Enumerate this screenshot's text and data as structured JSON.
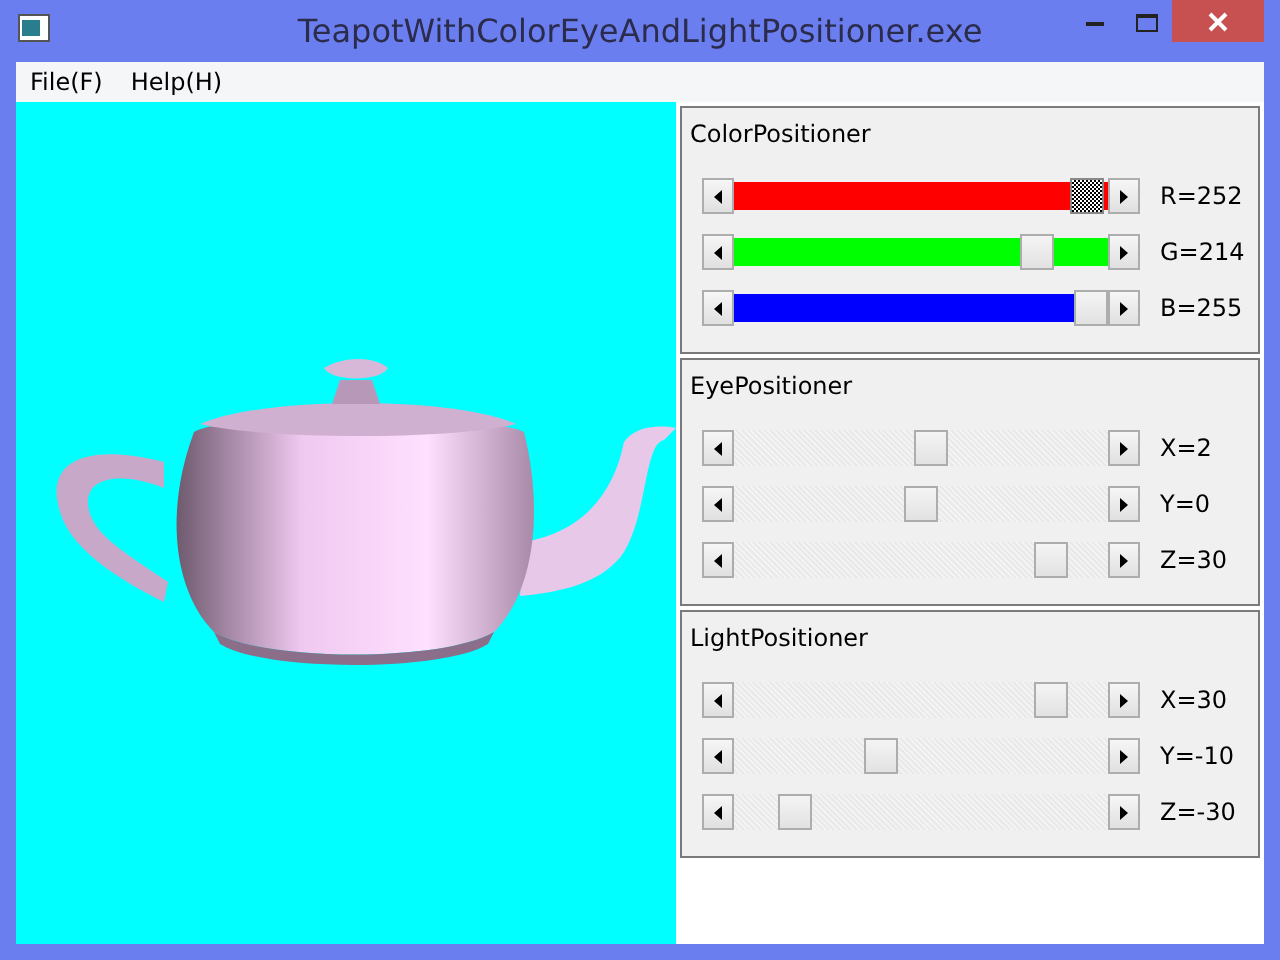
{
  "window": {
    "title": "TeapotWithColorEyeAndLightPositioner.exe"
  },
  "menu": [
    {
      "label": "File(F)"
    },
    {
      "label": "Help(H)"
    }
  ],
  "panels": [
    {
      "title": "ColorPositioner",
      "sliders": [
        {
          "level": 0.99,
          "color": "#ff0000",
          "focused": true,
          "reading": "R=252"
        },
        {
          "level": 0.84,
          "color": "#00ff00",
          "focused": false,
          "reading": "G=214"
        },
        {
          "level": 1.0,
          "color": "#0000ff",
          "focused": false,
          "reading": "B=255"
        }
      ]
    },
    {
      "title": "EyePositioner",
      "sliders": [
        {
          "level": 0.53,
          "focused": false,
          "reading": "X=2"
        },
        {
          "level": 0.5,
          "focused": false,
          "reading": "Y=0"
        },
        {
          "level": 0.88,
          "focused": false,
          "reading": "Z=30"
        }
      ]
    },
    {
      "title": "LightPositioner",
      "sliders": [
        {
          "level": 0.88,
          "focused": false,
          "reading": "X=30"
        },
        {
          "level": 0.38,
          "focused": false,
          "reading": "Y=-10"
        },
        {
          "level": 0.13,
          "focused": false,
          "reading": "Z=-30"
        }
      ]
    }
  ]
}
